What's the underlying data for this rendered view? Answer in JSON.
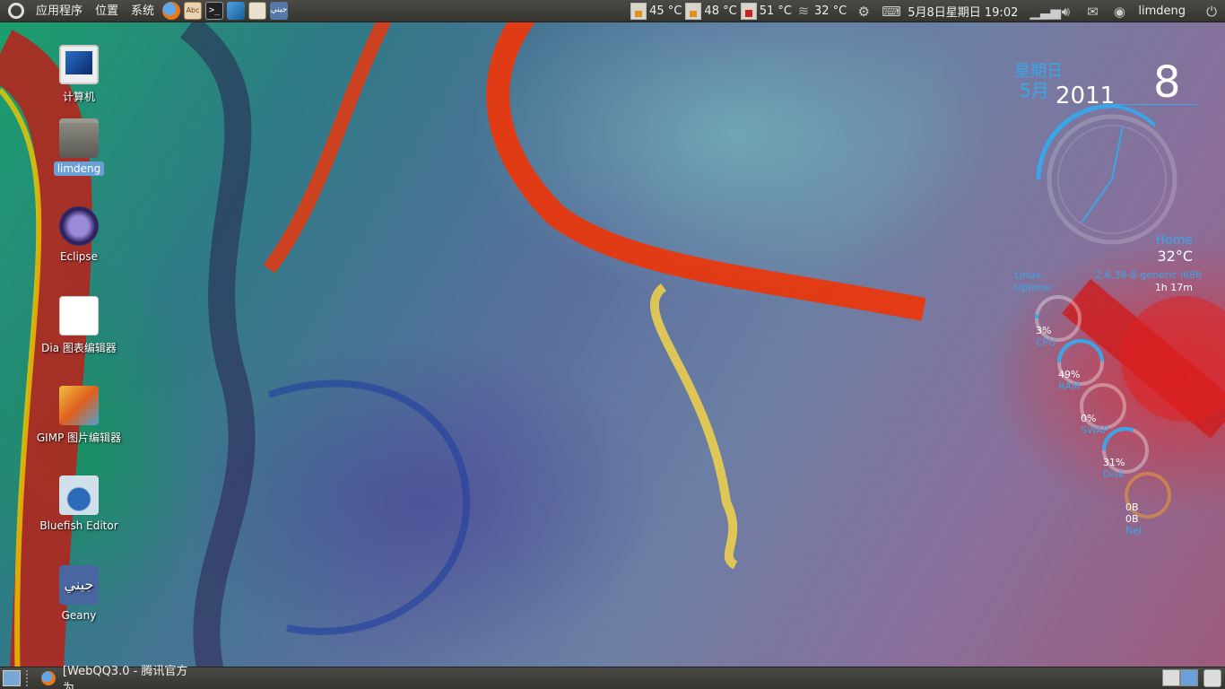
{
  "top_panel": {
    "menus": [
      {
        "label": "应用程序"
      },
      {
        "label": "位置"
      },
      {
        "label": "系统"
      }
    ],
    "launchers": [
      {
        "icon": "firefox-icon"
      },
      {
        "icon": "abiword-icon",
        "text": "Abc"
      },
      {
        "icon": "terminal-icon",
        "text": ">_"
      },
      {
        "icon": "app-icon"
      },
      {
        "icon": "text-editor-icon"
      },
      {
        "icon": "geany-icon",
        "text": "جيني"
      }
    ],
    "sensors": [
      {
        "value": "45 °C",
        "level": 0.45,
        "icon": "thermometer-icon"
      },
      {
        "value": "48 °C",
        "level": 0.48,
        "icon": "thermometer-icon"
      },
      {
        "value": "51 °C",
        "level": 0.51,
        "icon": "thermometer-hot-icon"
      },
      {
        "value": "32 °C",
        "icon": "weather-icon"
      }
    ],
    "clock": "5月8日星期日 19:02",
    "user": "limdeng"
  },
  "desktop_icons": [
    {
      "label": "计算机",
      "icon": "computer-icon",
      "selected": false
    },
    {
      "label": "limdeng",
      "icon": "home-folder-icon",
      "selected": true
    },
    {
      "label": "Eclipse",
      "icon": "eclipse-icon",
      "selected": false
    },
    {
      "label": "Dia 图表编辑器",
      "icon": "dia-icon",
      "selected": false
    },
    {
      "label": "GIMP 图片编辑器",
      "icon": "gimp-icon",
      "selected": false
    },
    {
      "label": "Bluefish Editor",
      "icon": "bluefish-icon",
      "selected": false
    },
    {
      "label": "Geany",
      "icon": "geany-icon",
      "glyph": "جيني",
      "selected": false
    }
  ],
  "conky": {
    "weekday": "星期日",
    "month": "5月",
    "year": "2011",
    "day": "8",
    "location": "Home",
    "temperature": "32°C",
    "os": "Linux",
    "kernel": "2.6.38-8-generic i686",
    "uptime_label": "Uptime:",
    "uptime": "1h 17m",
    "gauges": [
      {
        "name": "cpu",
        "value": "3%",
        "label": "CPU",
        "fraction": 0.03
      },
      {
        "name": "ram",
        "value": "49%",
        "label": "RAM",
        "fraction": 0.49
      },
      {
        "name": "swap",
        "value": "0%",
        "label": "SWAP",
        "fraction": 0.0
      },
      {
        "name": "disk",
        "value": "31%",
        "label": "Disk",
        "fraction": 0.31
      }
    ],
    "net": {
      "down": "0B",
      "up": "0B",
      "label": "Net"
    },
    "accent_color": "#3aa6e8"
  },
  "bottom_panel": {
    "task": "[WebQQ3.0 - 腾讯官方为..."
  },
  "colors": {
    "panel": "#3f3e39",
    "accent": "#3aa6e8",
    "selection": "#6a9fd8"
  }
}
